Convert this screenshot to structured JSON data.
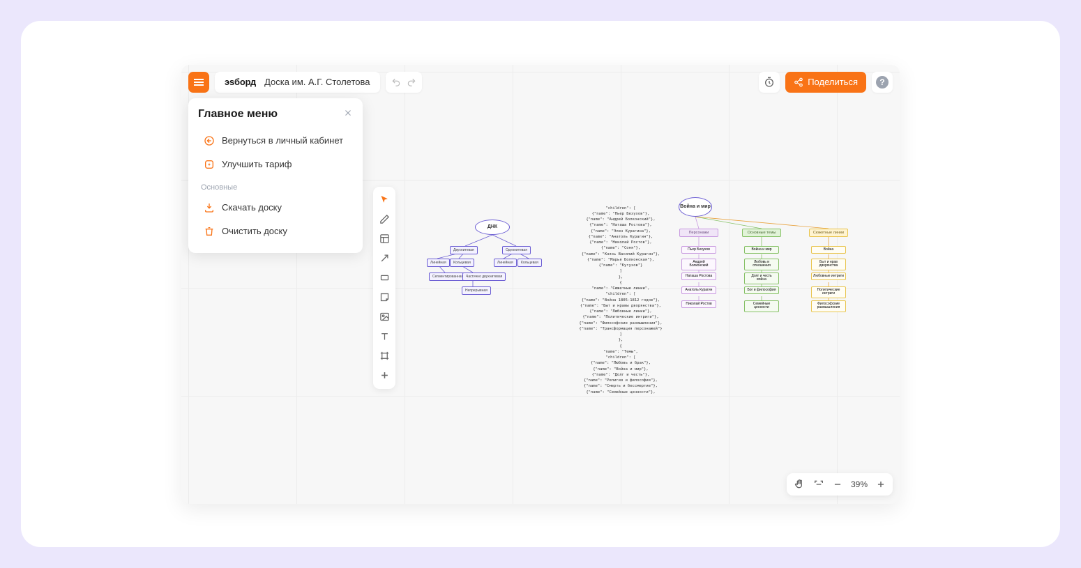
{
  "brand": "эsборд",
  "board_name": "Доска им. А.Г. Столетова",
  "share_label": "Поделиться",
  "menu": {
    "title": "Главное меню",
    "back_label": "Вернуться в личный кабинет",
    "upgrade_label": "Улучшить тариф",
    "section_label": "Основные",
    "download_label": "Скачать доску",
    "clear_label": "Очистить доску"
  },
  "zoom": {
    "value": "39%"
  },
  "dna": {
    "root": "ДНК",
    "l1a": "Двухнитевая",
    "l1b": "Однонитевая",
    "l2a": "Линейная",
    "l2b": "Кольцевая",
    "l2c": "Линейная",
    "l2d": "Кольцевая",
    "l3a": "Сегментированная",
    "l3b": "Частично двухнитевая",
    "l4": "Непрерывная"
  },
  "json_text": "\"children\": [\n{\"name\": \"Пьер Безухов\"},\n{\"name\": \"Андрей Болконский\"},\n{\"name\": \"Наташа Ростова\"},\n{\"name\": \"Элен Курагина\"},\n{\"name\": \"Анатоль Курагин\"},\n{\"name\": \"Николай Ростов\"},\n{\"name\": \"Соня\"},\n{\"name\": \"Князь Василий Курагин\"},\n{\"name\": \"Марья Болконская\"},\n{\"name\": \"Кутузов\"}\n]\n},\n{\n\"name\": \"Сюжетные линии\",\n\"children\": [\n{\"name\": \"Война 1805-1812 годов\"},\n{\"name\": \"Быт и нравы дворянства\"},\n{\"name\": \"Любовные линии\"},\n{\"name\": \"Политические интриги\"},\n{\"name\": \"Философские размышления\"},\n{\"name\": \"Трансформация персонажей\"}\n]\n},\n{\n\"name\": \"Темы\",\n\"children\": [\n{\"name\": \"Любовь и брак\"},\n{\"name\": \"Война и мир\"},\n{\"name\": \"Долг и честь\"},\n{\"name\": \"Религия и философия\"},\n{\"name\": \"Смерть и бессмертие\"},\n{\"name\": \"Семейные ценности\"},",
  "wp": {
    "root": "Война и мир",
    "cat1": "Персонажи",
    "cat2": "Основные темы",
    "cat3": "Сюжетные линии",
    "col1": [
      "Пьер Безухов",
      "Андрей Болконский",
      "Наташа Ростова",
      "Анатоль Курагин",
      "Николай Ростов"
    ],
    "col2": [
      "Война и мир",
      "Любовь и отношения",
      "Долг и честь война",
      "Бог и философия",
      "Семейные ценности"
    ],
    "col3": [
      "Война",
      "Быт и нрав дворянства",
      "Любовные интриги",
      "Политические интриги",
      "Философские размышления"
    ]
  }
}
